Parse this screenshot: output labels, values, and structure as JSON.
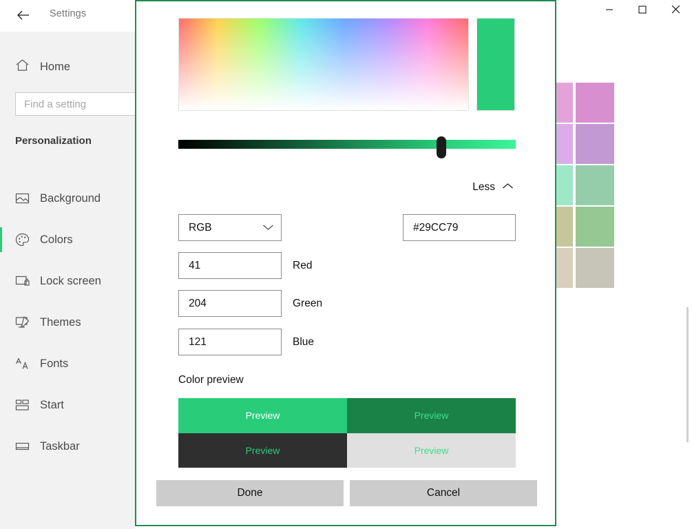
{
  "window": {
    "title": "Settings",
    "back_icon": "back-arrow-icon",
    "controls": {
      "minimize": "minimize-icon",
      "maximize": "maximize-icon",
      "close": "close-icon"
    }
  },
  "nav": {
    "home": {
      "label": "Home",
      "icon": "home-icon"
    },
    "search": {
      "placeholder": "Find a setting",
      "value": ""
    },
    "section_title": "Personalization",
    "items": [
      {
        "label": "Background",
        "icon": "picture-icon",
        "selected": false
      },
      {
        "label": "Colors",
        "icon": "palette-icon",
        "selected": true
      },
      {
        "label": "Lock screen",
        "icon": "lock-screen-icon",
        "selected": false
      },
      {
        "label": "Themes",
        "icon": "themes-icon",
        "selected": false
      },
      {
        "label": "Fonts",
        "icon": "fonts-icon",
        "selected": false
      },
      {
        "label": "Start",
        "icon": "start-icon",
        "selected": false
      },
      {
        "label": "Taskbar",
        "icon": "taskbar-icon",
        "selected": false
      }
    ]
  },
  "content": {
    "swatch_rows": [
      {
        "narrow": "#e4a3d8",
        "wide": "#d78fd0"
      },
      {
        "narrow": "#dcacea",
        "wide": "#c399d4"
      },
      {
        "narrow": "#9de8c7",
        "wide": "#95ccaa"
      },
      {
        "narrow": "#c5c79a",
        "wide": "#96c894"
      },
      {
        "narrow": "#d9cfbc",
        "wide": "#c7c4b8"
      }
    ]
  },
  "dialog": {
    "border_color": "#1f8b52",
    "selected_color": "#29cc79",
    "spectrum": {
      "name": "color-spectrum"
    },
    "brightness": {
      "value_percent": 78,
      "track_end": "#3bf59a"
    },
    "less_toggle": {
      "label": "Less",
      "icon": "chevron-up-icon"
    },
    "mode_select": {
      "value": "RGB",
      "icon": "chevron-down-icon"
    },
    "hex": {
      "value": "#29CC79"
    },
    "channels": [
      {
        "label": "Red",
        "value": "41"
      },
      {
        "label": "Green",
        "value": "204"
      },
      {
        "label": "Blue",
        "value": "121"
      }
    ],
    "preview": {
      "heading": "Color preview",
      "cells": [
        {
          "label": "Preview",
          "bg": "#29cc79",
          "fg": "#ffffff"
        },
        {
          "label": "Preview",
          "bg": "#1a8247",
          "fg": "#3ddd8c"
        },
        {
          "label": "Preview",
          "bg": "#2f2f2f",
          "fg": "#29cc79"
        },
        {
          "label": "Preview",
          "bg": "#e0e0e0",
          "fg": "#3ddd8c"
        }
      ]
    },
    "buttons": {
      "done": "Done",
      "cancel": "Cancel"
    }
  }
}
